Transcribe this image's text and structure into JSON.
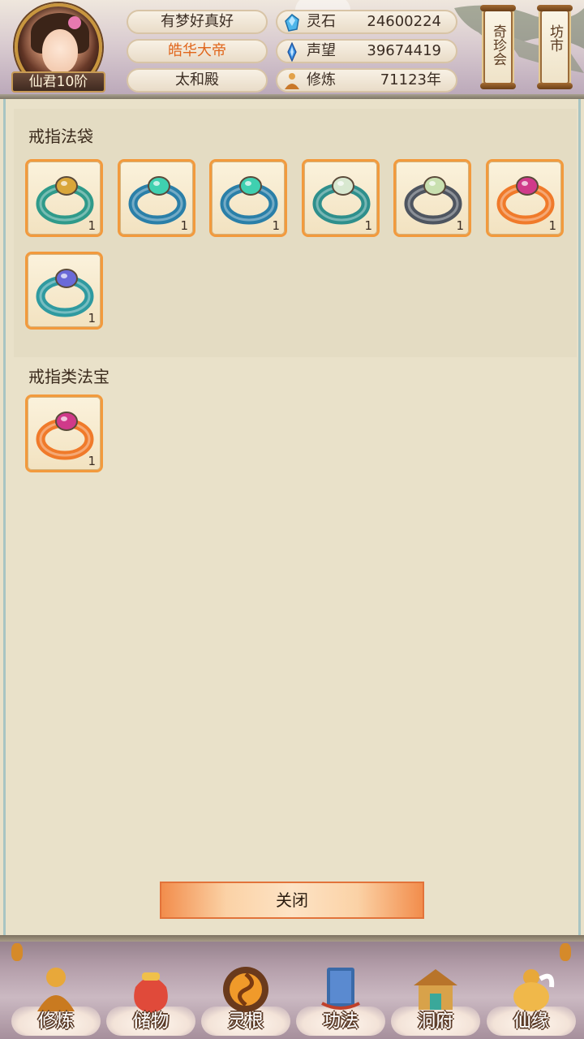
{
  "header": {
    "rank": "仙君10阶",
    "player_name": "有梦好真好",
    "player_title": "皓华大帝",
    "palace": "太和殿",
    "stats": [
      {
        "icon": "spirit-stone-icon",
        "label": "灵石",
        "value": "24600224"
      },
      {
        "icon": "reputation-icon",
        "label": "声望",
        "value": "39674419"
      },
      {
        "icon": "cultivation-icon",
        "label": "修炼",
        "value": "71123年"
      }
    ],
    "side_buttons": [
      "奇珍会",
      "坊市"
    ]
  },
  "sections": [
    {
      "title": "戒指法袋",
      "items": [
        {
          "icon": "gold-teal-ring-icon",
          "qty": "1",
          "colors": [
            "#2f9a8a",
            "#d9a63a"
          ]
        },
        {
          "icon": "blue-jade-ring-icon",
          "qty": "1",
          "colors": [
            "#2a7fa8",
            "#3fd0b0"
          ]
        },
        {
          "icon": "blue-jade-ring-icon",
          "qty": "1",
          "colors": [
            "#2a7fa8",
            "#3fd0b0"
          ]
        },
        {
          "icon": "silver-pearl-ring-icon",
          "qty": "1",
          "colors": [
            "#2e8f8c",
            "#d8e8d0"
          ]
        },
        {
          "icon": "gray-pearl-ring-icon",
          "qty": "1",
          "colors": [
            "#4e5560",
            "#c9e0b0"
          ]
        },
        {
          "icon": "flame-ruby-ring-icon",
          "qty": "1",
          "colors": [
            "#f07a2a",
            "#d03a8a"
          ]
        },
        {
          "icon": "sapphire-ring-icon",
          "qty": "1",
          "colors": [
            "#2f9aa0",
            "#6a6ad8"
          ]
        }
      ]
    },
    {
      "title": "戒指类法宝",
      "items": [
        {
          "icon": "flame-ruby-ring-icon",
          "qty": "1",
          "colors": [
            "#f07a2a",
            "#d03a8a"
          ]
        }
      ]
    }
  ],
  "close_label": "关闭",
  "nav": [
    {
      "label": "修炼",
      "icon": "cultivation-figure-icon"
    },
    {
      "label": "储物",
      "icon": "storage-bag-icon"
    },
    {
      "label": "灵根",
      "icon": "spirit-root-icon"
    },
    {
      "label": "功法",
      "icon": "technique-book-icon"
    },
    {
      "label": "洞府",
      "icon": "cave-residence-icon"
    },
    {
      "label": "仙缘",
      "icon": "immortal-fate-icon"
    }
  ]
}
